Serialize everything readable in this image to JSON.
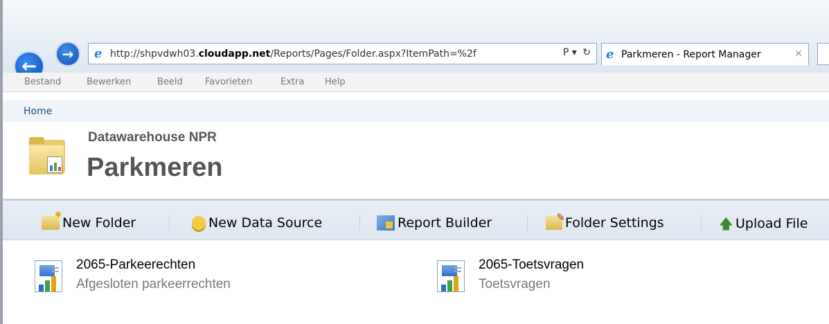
{
  "browser": {
    "address": {
      "url_prefix": "http://shpvdwh03.",
      "url_domain": "cloudapp.net",
      "url_suffix": "/Reports/Pages/Folder.aspx?ItemPath=%2f",
      "search_icon": "Ρ ▾",
      "refresh_icon": "↻"
    },
    "tab": {
      "title": "Parkmeren - Report Manager",
      "close": "✕"
    },
    "menu": [
      "Bestand",
      "Bewerken",
      "Beeld",
      "Favorieten",
      "Extra",
      "Help"
    ]
  },
  "breadcrumb": {
    "home": "Home"
  },
  "header": {
    "site_name": "Datawarehouse NPR",
    "page_title": "Parkmeren"
  },
  "toolbar": {
    "new_folder": "New Folder",
    "new_data_source": "New Data Source",
    "report_builder": "Report Builder",
    "folder_settings": "Folder Settings",
    "upload_file": "Upload File"
  },
  "items": [
    {
      "name": "2065-Parkeerechten",
      "description": "Afgesloten parkeerrechten"
    },
    {
      "name": "2065-Toetsvragen",
      "description": "Toetsvragen"
    }
  ],
  "colors": {
    "accent": "#1a4f8a",
    "title_gray": "#555555",
    "toolbar_bg": "#e4eaf2",
    "back_button": "#0a4fb6"
  }
}
